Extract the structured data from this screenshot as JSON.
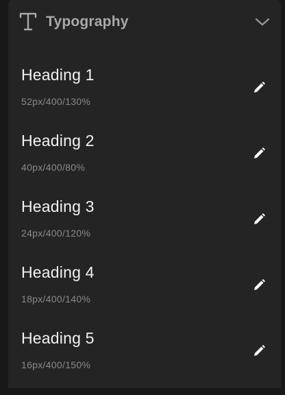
{
  "section": {
    "title": "Typography",
    "icon": "text-type-icon",
    "collapse_icon": "chevron-down-icon"
  },
  "styles": [
    {
      "name": "Heading 1",
      "spec": "52px/400/130%"
    },
    {
      "name": "Heading 2",
      "spec": "40px/400/80%"
    },
    {
      "name": "Heading 3",
      "spec": "24px/400/120%"
    },
    {
      "name": "Heading 4",
      "spec": "18px/400/140%"
    },
    {
      "name": "Heading 5",
      "spec": "16px/400/150%"
    }
  ],
  "colors": {
    "background": "#181818",
    "panel": "#242424",
    "title": "#a9a9a9",
    "text": "#f2f2f2",
    "muted": "#8a8a8a"
  }
}
